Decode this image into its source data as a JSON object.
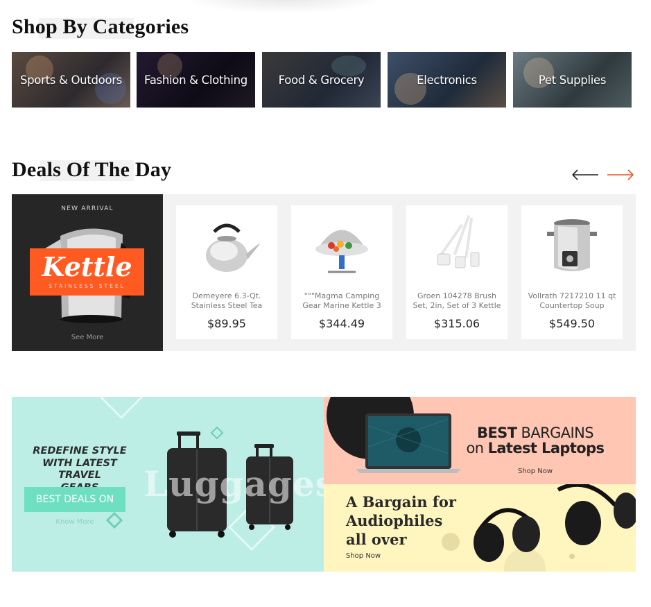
{
  "sections": {
    "shop_title": "Shop By Categories",
    "deals_title": "Deals Of The Day"
  },
  "categories": [
    {
      "label": "Sports & Outdoors",
      "bg": "#3d3a39"
    },
    {
      "label": "Fashion & Clothing",
      "bg": "#171220"
    },
    {
      "label": "Food & Grocery",
      "bg": "#2a2f3a"
    },
    {
      "label": "Electronics",
      "bg": "#263447"
    },
    {
      "label": "Pet Supplies",
      "bg": "#384246"
    }
  ],
  "deals": {
    "nav": {
      "prev_icon": "arrow-left-icon",
      "next_icon": "arrow-right-icon",
      "prev_color": "#222222",
      "next_color": "#e8552b"
    },
    "promo": {
      "tag": "NEW ARRIVAL",
      "title": "Kettle",
      "subtitle": "STAINLESS STEEL",
      "link": "See More",
      "accent": "#ff5a22"
    },
    "products": [
      {
        "name": "Demeyere 6.3-Qt. Stainless Steel Tea",
        "price": "$89.95"
      },
      {
        "name": "\"\"\"Magma Camping Gear Marine Kettle 3",
        "price": "$344.49"
      },
      {
        "name": "Groen 104278 Brush Set, 2in, Set of 3 Kettle",
        "price": "$315.06"
      },
      {
        "name": "Vollrath 7217210 11 qt Countertop Soup",
        "price": "$549.50"
      }
    ]
  },
  "banners": {
    "luggage": {
      "line1": "REDEFINE STYLE",
      "line2": "WITH LATEST TRAVEL",
      "line3": "GEARS",
      "button": "BEST DEALS ON",
      "link": "Know More",
      "word": "Luggages",
      "bg": "#bdeee6"
    },
    "laptops": {
      "line1_bold": "BEST",
      "line1_rest": " BARGAINS",
      "line2_pre": "on ",
      "line2_bold": "Latest Laptops",
      "link": "Shop Now",
      "bg": "#ffc6b4"
    },
    "audio": {
      "line1": "A Bargain for",
      "line2": "Audiophiles",
      "line3": "all over",
      "link": "Shop Now",
      "bg": "#fff5bf"
    }
  }
}
